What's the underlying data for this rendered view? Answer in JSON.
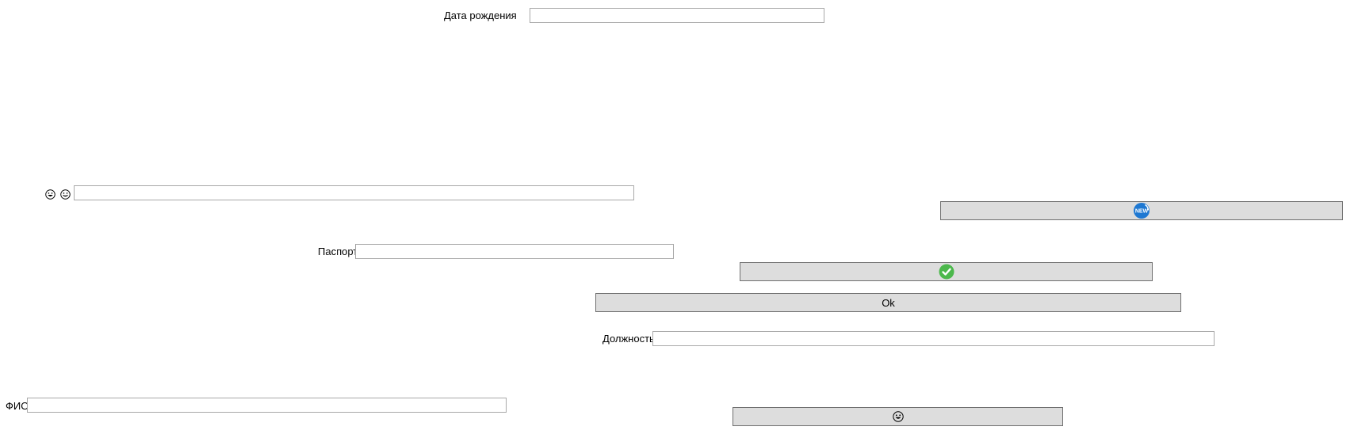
{
  "birth_date": {
    "label": "Дата рождения",
    "value": ""
  },
  "emoji_field": {
    "value": ""
  },
  "passport": {
    "label": "Паспорт",
    "value": ""
  },
  "position": {
    "label": "Должность",
    "value": ""
  },
  "full_name": {
    "label": "ФИО",
    "value": ""
  },
  "buttons": {
    "ok_label": "Ok"
  },
  "icons": {
    "emoji_label_1": "grinning-face-icon",
    "emoji_label_2": "smiling-face-icon",
    "new_button": "new-badge-icon",
    "check_button": "checkmark-icon",
    "emoji_button": "grinning-face-icon"
  },
  "colors": {
    "button_face": "#dddddd",
    "button_border": "#6f6f6f",
    "field_border": "#a9a9a9",
    "new_badge": "#1e78d2",
    "check_green": "#4cb84c"
  }
}
